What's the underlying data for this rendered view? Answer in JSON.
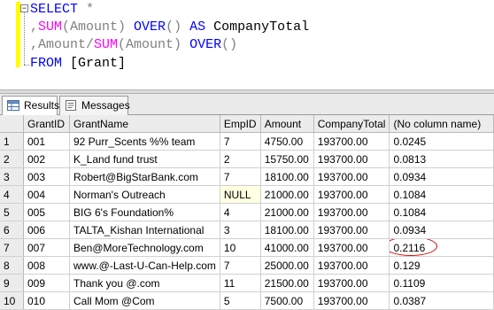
{
  "sql": {
    "line1": {
      "kw_select": "SELECT",
      "star": " *"
    },
    "line2": {
      "comma": ",",
      "fn_sum": "SUM",
      "args": "(Amount) ",
      "kw_over": "OVER",
      "paren": "() ",
      "kw_as": "AS",
      "alias": " CompanyTotal"
    },
    "line3": {
      "lead": ",Amount",
      "slash": "/",
      "fn_sum": "SUM",
      "args": "(Amount) ",
      "kw_over": "OVER",
      "paren": "()"
    },
    "line4": {
      "kw_from": "FROM",
      "table": " [Grant]"
    }
  },
  "tabs": {
    "results_label": "Results",
    "messages_label": "Messages"
  },
  "grid": {
    "columns": [
      "",
      "GrantID",
      "GrantName",
      "EmpID",
      "Amount",
      "CompanyTotal",
      "(No column name)"
    ],
    "rows": [
      [
        "1",
        "001",
        "92 Purr_Scents %% team",
        "7",
        "4750.00",
        "193700.00",
        "0.0245"
      ],
      [
        "2",
        "002",
        "K_Land fund trust",
        "2",
        "15750.00",
        "193700.00",
        "0.0813"
      ],
      [
        "3",
        "003",
        "Robert@BigStarBank.com",
        "7",
        "18100.00",
        "193700.00",
        "0.0934"
      ],
      [
        "4",
        "004",
        "Norman's Outreach",
        "NULL",
        "21000.00",
        "193700.00",
        "0.1084"
      ],
      [
        "5",
        "005",
        "BIG 6's Foundation%",
        "4",
        "21000.00",
        "193700.00",
        "0.1084"
      ],
      [
        "6",
        "006",
        "TALTA_Kishan International",
        "3",
        "18100.00",
        "193700.00",
        "0.0934"
      ],
      [
        "7",
        "007",
        "Ben@MoreTechnology.com",
        "10",
        "41000.00",
        "193700.00",
        "0.2116"
      ],
      [
        "8",
        "008",
        "www.@-Last-U-Can-Help.com",
        "7",
        "25000.00",
        "193700.00",
        "0.129"
      ],
      [
        "9",
        "009",
        "Thank you @.com",
        "11",
        "21500.00",
        "193700.00",
        "0.1109"
      ],
      [
        "10",
        "010",
        "Call Mom @Com",
        "5",
        "7500.00",
        "193700.00",
        "0.0387"
      ]
    ]
  },
  "colors": {
    "keyword": "#0000ff",
    "function": "#ff00ff",
    "operator": "#808080",
    "annotation_circle": "#d00000",
    "null_cell": "#ffffe1"
  }
}
